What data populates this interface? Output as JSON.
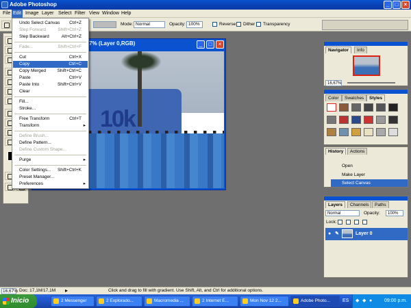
{
  "app": {
    "title": "Adobe Photoshop",
    "window_buttons": [
      "_",
      "□",
      "×"
    ]
  },
  "menubar": {
    "items": [
      "File",
      "Edit",
      "Image",
      "Layer",
      "Select",
      "Filter",
      "View",
      "Window",
      "Help"
    ],
    "active": "Edit"
  },
  "options": {
    "mode_label": "Mode:",
    "mode_value": "Normal",
    "opacity_label": "Opacity:",
    "opacity_value": "100%",
    "reverse": "Reverse",
    "dither": "Dither",
    "transparency": "Transparency"
  },
  "document": {
    "title": "16,7% (Layer 0,RGB)",
    "banner_text": "10k"
  },
  "edit_menu": {
    "items": [
      {
        "label": "Undo Select Canvas",
        "shortcut": "Ctrl+Z",
        "state": "enabled"
      },
      {
        "label": "Step Forward",
        "shortcut": "Shift+Ctrl+Z",
        "state": "disabled"
      },
      {
        "label": "Step Backward",
        "shortcut": "Alt+Ctrl+Z",
        "state": "enabled"
      },
      {
        "label": "Fade...",
        "shortcut": "Shift+Ctrl+F",
        "state": "disabled"
      },
      {
        "label": "Cut",
        "shortcut": "Ctrl+X",
        "state": "enabled"
      },
      {
        "label": "Copy",
        "shortcut": "Ctrl+C",
        "state": "highlighted"
      },
      {
        "label": "Copy Merged",
        "shortcut": "Shift+Ctrl+C",
        "state": "enabled"
      },
      {
        "label": "Paste",
        "shortcut": "Ctrl+V",
        "state": "enabled"
      },
      {
        "label": "Paste Into",
        "shortcut": "Shift+Ctrl+V",
        "state": "enabled"
      },
      {
        "label": "Clear",
        "shortcut": "",
        "state": "enabled"
      },
      {
        "label": "Fill...",
        "shortcut": "",
        "state": "enabled"
      },
      {
        "label": "Stroke...",
        "shortcut": "",
        "state": "enabled"
      },
      {
        "label": "Free Transform",
        "shortcut": "Ctrl+T",
        "state": "enabled"
      },
      {
        "label": "Transform",
        "shortcut": "",
        "state": "enabled",
        "submenu": true
      },
      {
        "label": "Define Brush...",
        "shortcut": "",
        "state": "disabled"
      },
      {
        "label": "Define Pattern...",
        "shortcut": "",
        "state": "enabled"
      },
      {
        "label": "Define Custom Shape...",
        "shortcut": "",
        "state": "disabled"
      },
      {
        "label": "Purge",
        "shortcut": "",
        "state": "enabled",
        "submenu": true
      },
      {
        "label": "Color Settings...",
        "shortcut": "Shift+Ctrl+K",
        "state": "enabled"
      },
      {
        "label": "Preset Manager...",
        "shortcut": "",
        "state": "enabled"
      },
      {
        "label": "Preferences",
        "shortcut": "",
        "state": "enabled",
        "submenu": true
      }
    ]
  },
  "navigator": {
    "tabs": [
      "Navigator",
      "Info"
    ],
    "zoom": "16,67%"
  },
  "styles": {
    "tabs": [
      "Color",
      "Swatches",
      "Styles"
    ]
  },
  "history": {
    "tabs": [
      "History",
      "Actions"
    ],
    "items": [
      "Open",
      "Make Layer",
      "Select Canvas"
    ],
    "selected": "Select Canvas"
  },
  "layers": {
    "tabs": [
      "Layers",
      "Channels",
      "Paths"
    ],
    "blend_mode": "Normal",
    "opacity_label": "Opacity:",
    "opacity_value": "100%",
    "lock_label": "Lock:",
    "layer_name": "Layer 0"
  },
  "statusbar": {
    "zoom": "16,67%",
    "doc_size": "Doc: 17,1M/17,1M",
    "hint": "Click and drag to fill with gradient. Use Shift, Alt, and Ctrl for additional options."
  },
  "taskbar": {
    "start": "Inicio",
    "tasks": [
      "2 Messenger",
      "2 Explorado...",
      "Macromedia ...",
      "2 Internet E...",
      "Mon Nov 12 2...",
      "Adobe Photo..."
    ],
    "language": "ES",
    "clock": "09:00 p.m."
  }
}
